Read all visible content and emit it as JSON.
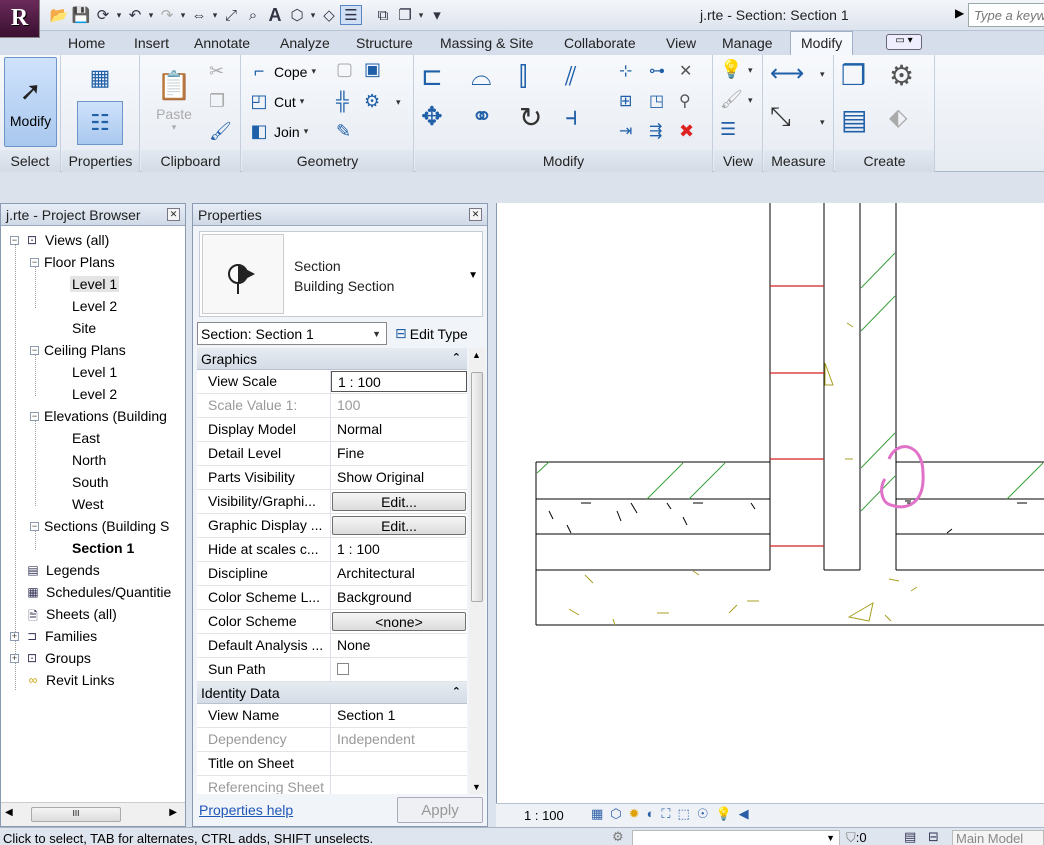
{
  "app": {
    "window_title": "j.rte - Section: Section 1",
    "search_placeholder": "Type a keyw",
    "app_letter": "R"
  },
  "tabs": [
    {
      "label": "Home"
    },
    {
      "label": "Insert"
    },
    {
      "label": "Annotate"
    },
    {
      "label": "Analyze"
    },
    {
      "label": "Structure"
    },
    {
      "label": "Massing & Site"
    },
    {
      "label": "Collaborate"
    },
    {
      "label": "View"
    },
    {
      "label": "Manage"
    },
    {
      "label": "Modify"
    }
  ],
  "ribbon": {
    "select": {
      "button": "Modify",
      "panel": "Select"
    },
    "properties": {
      "panel": "Properties"
    },
    "clipboard": {
      "paste": "Paste",
      "panel": "Clipboard"
    },
    "geometry": {
      "cope": "Cope",
      "cut": "Cut",
      "join": "Join",
      "panel": "Geometry"
    },
    "modify": {
      "panel": "Modify"
    },
    "view": {
      "panel": "View"
    },
    "measure": {
      "panel": "Measure"
    },
    "create": {
      "panel": "Create"
    }
  },
  "project_browser": {
    "title": "j.rte - Project Browser",
    "nodes": [
      {
        "label": "Views (all)"
      },
      {
        "label": "Floor Plans"
      },
      {
        "label": "Level 1"
      },
      {
        "label": "Level 2"
      },
      {
        "label": "Site"
      },
      {
        "label": "Ceiling Plans"
      },
      {
        "label": "Level 1"
      },
      {
        "label": "Level 2"
      },
      {
        "label": "Elevations (Building"
      },
      {
        "label": "East"
      },
      {
        "label": "North"
      },
      {
        "label": "South"
      },
      {
        "label": "West"
      },
      {
        "label": "Sections (Building S"
      },
      {
        "label": "Section 1"
      },
      {
        "label": "Legends"
      },
      {
        "label": "Schedules/Quantitie"
      },
      {
        "label": "Sheets (all)"
      },
      {
        "label": "Families"
      },
      {
        "label": "Groups"
      },
      {
        "label": "Revit Links"
      }
    ],
    "scroll_grip": "III"
  },
  "properties": {
    "title": "Properties",
    "type_family": "Section",
    "type_name": "Building Section",
    "instance_selector": "Section: Section 1",
    "edit_type": "Edit Type",
    "groups": [
      {
        "name": "Graphics",
        "rows": [
          {
            "key": "View Scale",
            "value": "1 : 100"
          },
          {
            "key": "Scale Value    1:",
            "value": "100"
          },
          {
            "key": "Display Model",
            "value": "Normal"
          },
          {
            "key": "Detail Level",
            "value": "Fine"
          },
          {
            "key": "Parts Visibility",
            "value": "Show Original"
          },
          {
            "key": "Visibility/Graphi...",
            "value": "Edit..."
          },
          {
            "key": "Graphic Display ...",
            "value": "Edit..."
          },
          {
            "key": "Hide at scales c...",
            "value": "1 : 100"
          },
          {
            "key": "Discipline",
            "value": "Architectural"
          },
          {
            "key": "Color Scheme L...",
            "value": "Background"
          },
          {
            "key": "Color Scheme",
            "value": "<none>"
          },
          {
            "key": "Default Analysis ...",
            "value": "None"
          },
          {
            "key": "Sun Path",
            "value": ""
          }
        ]
      },
      {
        "name": "Identity Data",
        "rows": [
          {
            "key": "View Name",
            "value": "Section 1"
          },
          {
            "key": "Dependency",
            "value": "Independent"
          },
          {
            "key": "Title on Sheet",
            "value": ""
          },
          {
            "key": "Referencing Sheet",
            "value": ""
          }
        ]
      }
    ],
    "help_link": "Properties help",
    "apply": "Apply"
  },
  "view_control_bar": {
    "scale": "1 : 100"
  },
  "status_bar": {
    "text": "Click to select, TAB for alternates, CTRL adds, SHIFT unselects.",
    "filter_count": ":0",
    "main_model": "Main Model"
  },
  "colors": {
    "accent_blue": "#2060a8",
    "hatch_green": "#3aa03a",
    "level_red": "#d42020",
    "markup_pink": "#e070c8"
  }
}
